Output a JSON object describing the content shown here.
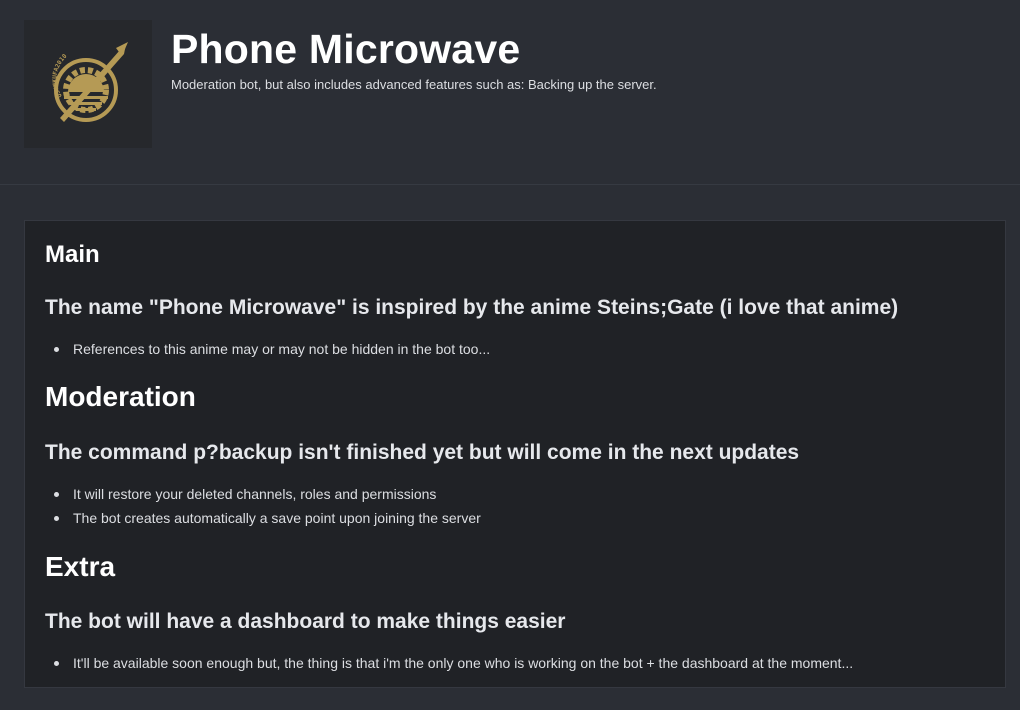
{
  "bot": {
    "name": "Phone Microwave",
    "description": "Moderation bot, but also includes advanced features such as: Backing up the server.",
    "logo_icon": "future-gadget-lab-emblem-icon",
    "logo_text": "OSHMKUFA2010"
  },
  "colors": {
    "page_background": "#2b2e35",
    "card_background": "#202226",
    "logo_gold": "#b59a55",
    "heading_text": "#ffffff",
    "body_text": "#dcdee2"
  },
  "sections": [
    {
      "title": "Main",
      "subtitle": "The name \"Phone Microwave\" is inspired by the anime Steins;Gate (i love that anime)",
      "bullets": [
        "References to this anime may or may not be hidden in the bot too..."
      ]
    },
    {
      "title": "Moderation",
      "subtitle": "The command p?backup isn't finished yet but will come in the next updates",
      "bullets": [
        "It will restore your deleted channels, roles and permissions",
        "The bot creates automatically a save point upon joining the server"
      ]
    },
    {
      "title": "Extra",
      "subtitle": "The bot will have a dashboard to make things easier",
      "bullets": [
        "It'll be available soon enough but, the thing is that i'm the only one who is working on the bot + the dashboard at the moment..."
      ]
    }
  ]
}
